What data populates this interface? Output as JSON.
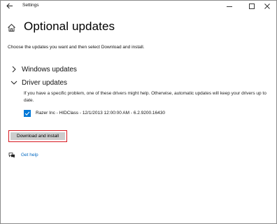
{
  "window": {
    "title": "Settings"
  },
  "header": {
    "title": "Optional updates"
  },
  "intro_text": "Choose the updates you want and then select Download and install.",
  "sections": {
    "windows_updates": {
      "label": "Windows updates",
      "expanded": false
    },
    "driver_updates": {
      "label": "Driver updates",
      "expanded": true,
      "description": "If you have a specific problem, one of these drivers might help. Otherwise, automatic updates will keep your drivers up to date.",
      "items": [
        {
          "label": "Razer Inc - HIDClass - 12/1/2013 12:00:00 AM - 6.2.9200.16430",
          "checked": true
        }
      ]
    }
  },
  "actions": {
    "download_label": "Download and install"
  },
  "help": {
    "label": "Get help"
  },
  "colors": {
    "accent": "#0078d7",
    "link": "#0067c0",
    "highlight_border": "#d71920",
    "button_bg": "#cccccc"
  }
}
